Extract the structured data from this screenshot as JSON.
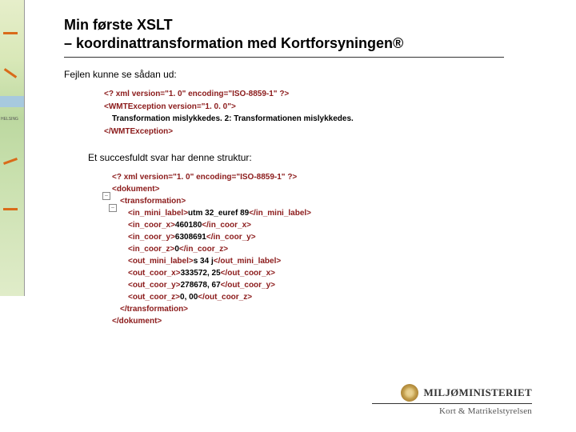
{
  "heading": {
    "line1": "Min første XSLT",
    "line2": "– koordinattransformation med Kortforsyningen®"
  },
  "intro1": "Fejlen kunne se sådan ud:",
  "error_block": {
    "l1": "<? xml version=\"1. 0\" encoding=\"ISO-8859-1\" ?>",
    "l2_open": "<WMTException version=\"1. 0. 0\">",
    "l2_text": "Transformation mislykkedes. 2: Transformationen mislykkedes.",
    "l2_close": "</WMTException>"
  },
  "intro2": "Et succesfuldt svar har denne struktur:",
  "success_block": {
    "xml_decl": "<? xml version=\"1. 0\" encoding=\"ISO-8859-1\" ?>",
    "dok_open": "<dokument>",
    "trans_open": "<transformation>",
    "lines": [
      {
        "open": "<in_mini_label>",
        "val": "utm 32_euref 89",
        "close": "</in_mini_label>"
      },
      {
        "open": "<in_coor_x>",
        "val": "460180",
        "close": "</in_coor_x>"
      },
      {
        "open": "<in_coor_y>",
        "val": "6308691",
        "close": "</in_coor_y>"
      },
      {
        "open": "<in_coor_z>",
        "val": "0",
        "close": "</in_coor_z>"
      },
      {
        "open": "<out_mini_label>",
        "val": "s 34 j",
        "close": "</out_mini_label>"
      },
      {
        "open": "<out_coor_x>",
        "val": "333572, 25",
        "close": "</out_coor_x>"
      },
      {
        "open": "<out_coor_y>",
        "val": "278678, 67",
        "close": "</out_coor_y>"
      },
      {
        "open": "<out_coor_z>",
        "val": "0, 00",
        "close": "</out_coor_z>"
      }
    ],
    "trans_close": "</transformation>",
    "dok_close": "</dokument>"
  },
  "logo": {
    "ministry": "MILJØMINISTERIET",
    "agency": "Kort & Matrikelstyrelsen"
  },
  "map_label": "HELSING"
}
